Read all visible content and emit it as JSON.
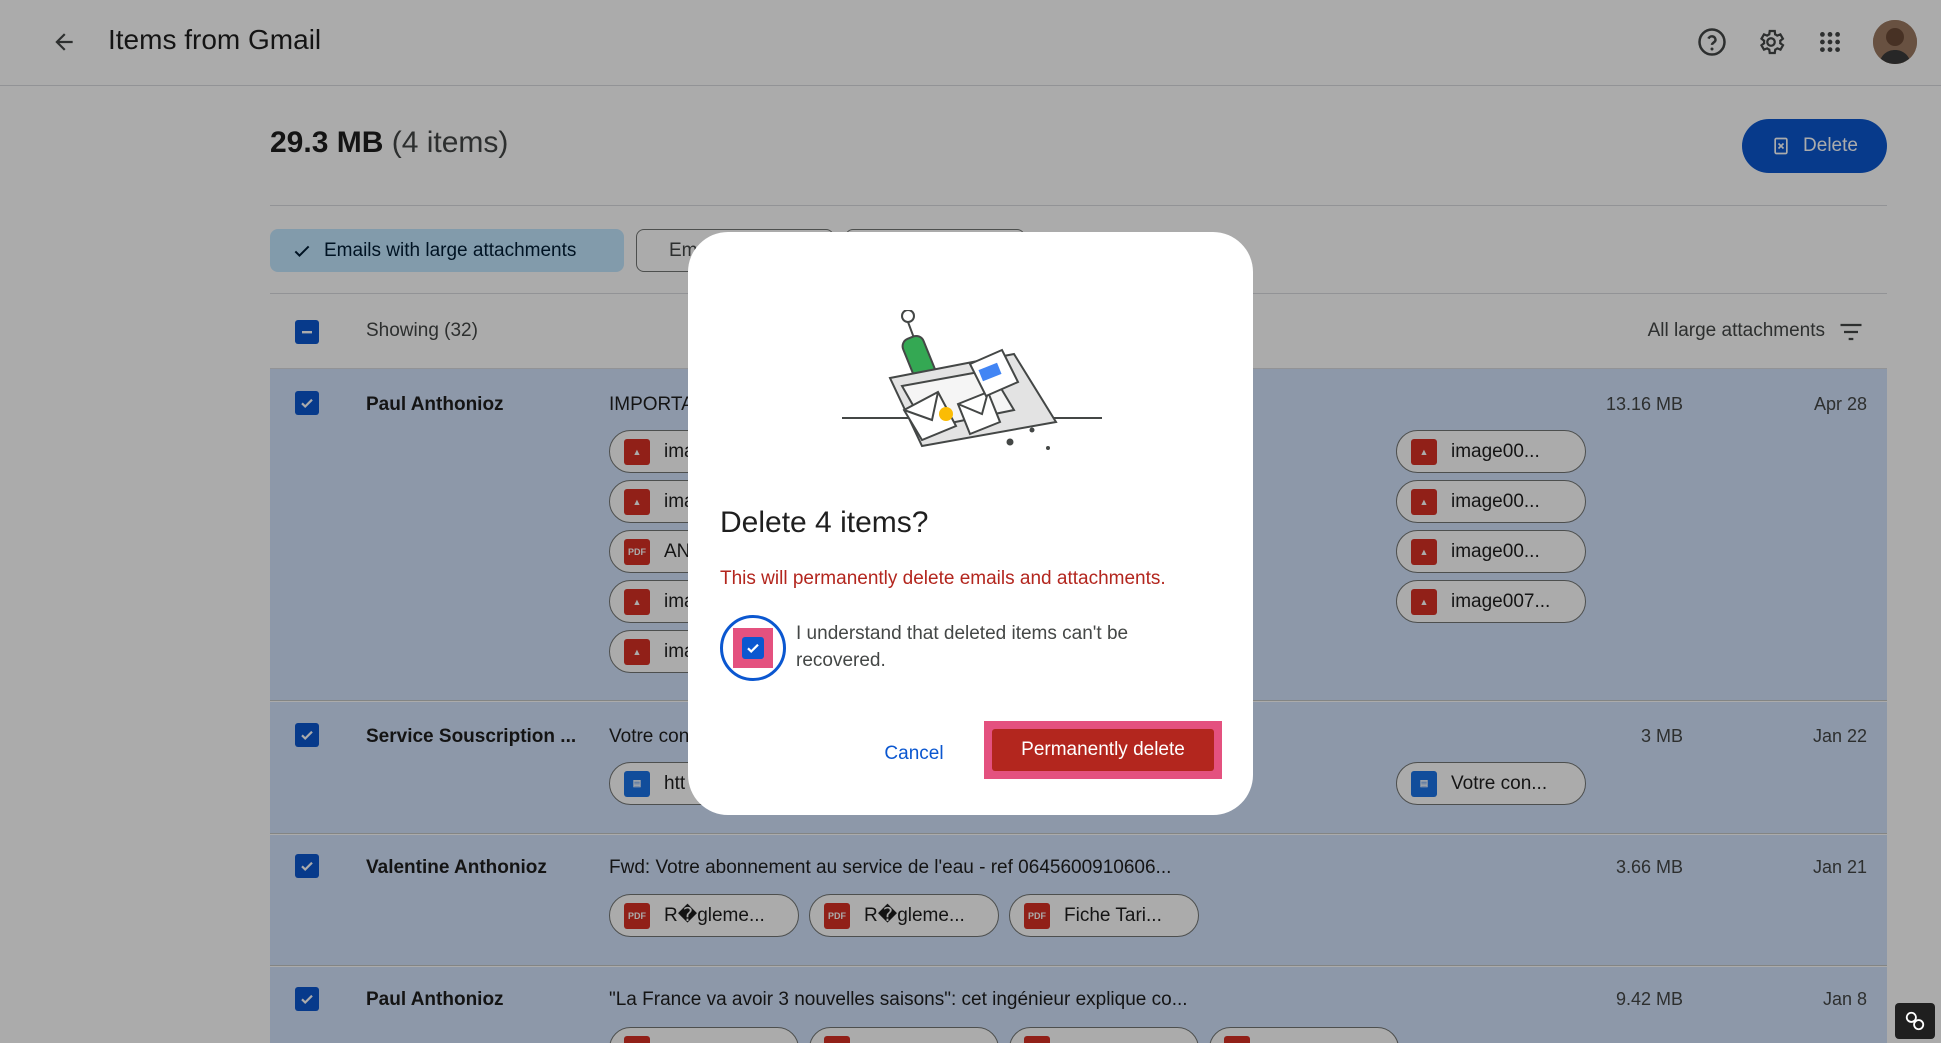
{
  "header": {
    "title": "Items from Gmail",
    "icons": [
      "arrow-back-icon",
      "help-icon",
      "settings-icon",
      "apps-grid-icon",
      "account-avatar"
    ]
  },
  "summary": {
    "size": "29.3 MB",
    "count": "(4 items)",
    "delete_label": "Delete"
  },
  "chips": [
    {
      "label": "Emails with large attachments",
      "selected": true
    },
    {
      "label": "Em",
      "selected": false
    },
    {
      "label": "",
      "selected": false
    }
  ],
  "list": {
    "showing": "Showing (32)",
    "filter_label": "All large attachments"
  },
  "rows": [
    {
      "sender": "Paul Anthonioz",
      "subject": "IMPORTA",
      "size": "13.16 MB",
      "date": "Apr 28",
      "attachments_left": [
        {
          "type": "image",
          "name": "ima"
        },
        {
          "type": "image",
          "name": "ima"
        },
        {
          "type": "pdf",
          "name": "AN"
        },
        {
          "type": "image",
          "name": "ima"
        },
        {
          "type": "image",
          "name": "ima"
        }
      ],
      "attachments_right": [
        "image00...",
        "image00...",
        "image00...",
        "image007..."
      ]
    },
    {
      "sender": "Service Souscription ...",
      "subject": "Votre con",
      "size": "3 MB",
      "date": "Jan 22",
      "attachments_left": [
        {
          "type": "doc",
          "name": "htt"
        }
      ],
      "attachments_right": [
        "Votre con..."
      ]
    },
    {
      "sender": "Valentine Anthonioz",
      "subject": "Fwd: Votre abonnement au service de l'eau - ref 0645600910606...",
      "size": "3.66 MB",
      "date": "Jan 21",
      "attachments": [
        "R�gleme...",
        "R�gleme...",
        "Fiche Tari..."
      ]
    },
    {
      "sender": "Paul Anthonioz",
      "subject": "\"La France va avoir 3 nouvelles saisons\": cet ingénieur explique co...",
      "size": "9.42 MB",
      "date": "Jan 8"
    }
  ],
  "dialog": {
    "title": "Delete 4 items?",
    "warning": "This will permanently delete emails and attachments.",
    "acknowledge": "I understand that deleted items can't be recovered.",
    "acknowledge_checked": true,
    "cancel_label": "Cancel",
    "confirm_label": "Permanently delete"
  },
  "colors": {
    "primary": "#0b57d0",
    "danger": "#b3261e",
    "selected_row": "#d3e3fd",
    "chip_selected": "#c2e7ff",
    "highlight": "#e4517f"
  }
}
